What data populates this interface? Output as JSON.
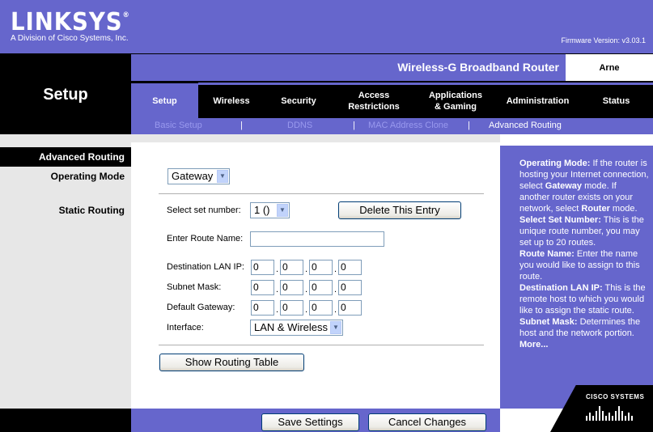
{
  "header": {
    "logo": "LINKSYS",
    "logo_mark": "®",
    "logo_sub": "A Division of Cisco Systems, Inc.",
    "firmware": "Firmware Version: v3.03.1",
    "product_name": "Wireless-G Broadband Router",
    "user": "Arne"
  },
  "section_title": "Setup",
  "tabs": [
    {
      "label": "Setup",
      "active": true
    },
    {
      "label": "Wireless"
    },
    {
      "label": "Security"
    },
    {
      "label": "Access Restrictions"
    },
    {
      "label": "Applications & Gaming"
    },
    {
      "label": "Administration"
    },
    {
      "label": "Status"
    }
  ],
  "subtabs": [
    "Basic Setup",
    "DDNS",
    "MAC Address Clone",
    "Advanced Routing"
  ],
  "subtab_separator": "|",
  "left_labels": {
    "advanced_routing": "Advanced Routing",
    "operating_mode": "Operating Mode",
    "static_routing": "Static Routing"
  },
  "form": {
    "operating_mode_value": "Gateway",
    "select_set_label": "Select set number:",
    "select_set_value": "1 ()",
    "delete_button": "Delete This Entry",
    "route_name_label": "Enter Route Name:",
    "route_name_value": "",
    "dest_lan_ip_label": "Destination LAN IP:",
    "dest_lan_ip": [
      "0",
      "0",
      "0",
      "0"
    ],
    "subnet_mask_label": "Subnet Mask:",
    "subnet_mask": [
      "0",
      "0",
      "0",
      "0"
    ],
    "default_gateway_label": "Default Gateway:",
    "default_gateway": [
      "0",
      "0",
      "0",
      "0"
    ],
    "interface_label": "Interface:",
    "interface_value": "LAN & Wireless",
    "show_table_button": "Show Routing Table",
    "octet_dot": "."
  },
  "footer": {
    "save": "Save Settings",
    "cancel": "Cancel Changes"
  },
  "help": [
    {
      "term": "Operating Mode:",
      "text": " If the router is hosting your Internet connection, select "
    },
    {
      "term": "Gateway",
      "text": " mode. If another router exists on your network, select "
    },
    {
      "term": "Router",
      "text": " mode."
    },
    {
      "term": "Select Set Number:",
      "text": " This is the unique route number, you may set up to 20 routes."
    },
    {
      "term": "Route Name:",
      "text": " Enter the name you would like to assign to this route."
    },
    {
      "term": "Destination LAN IP:",
      "text": " This is the remote host to which you would like to assign the static route."
    },
    {
      "term": "Subnet Mask:",
      "text": " Determines the host and the network portion."
    }
  ],
  "help_more": "More...",
  "cisco_logo": "CISCO SYSTEMS",
  "colors": {
    "brand_purple": "#6666cc",
    "black": "#000000",
    "panel_gray": "#e7e7e7"
  }
}
